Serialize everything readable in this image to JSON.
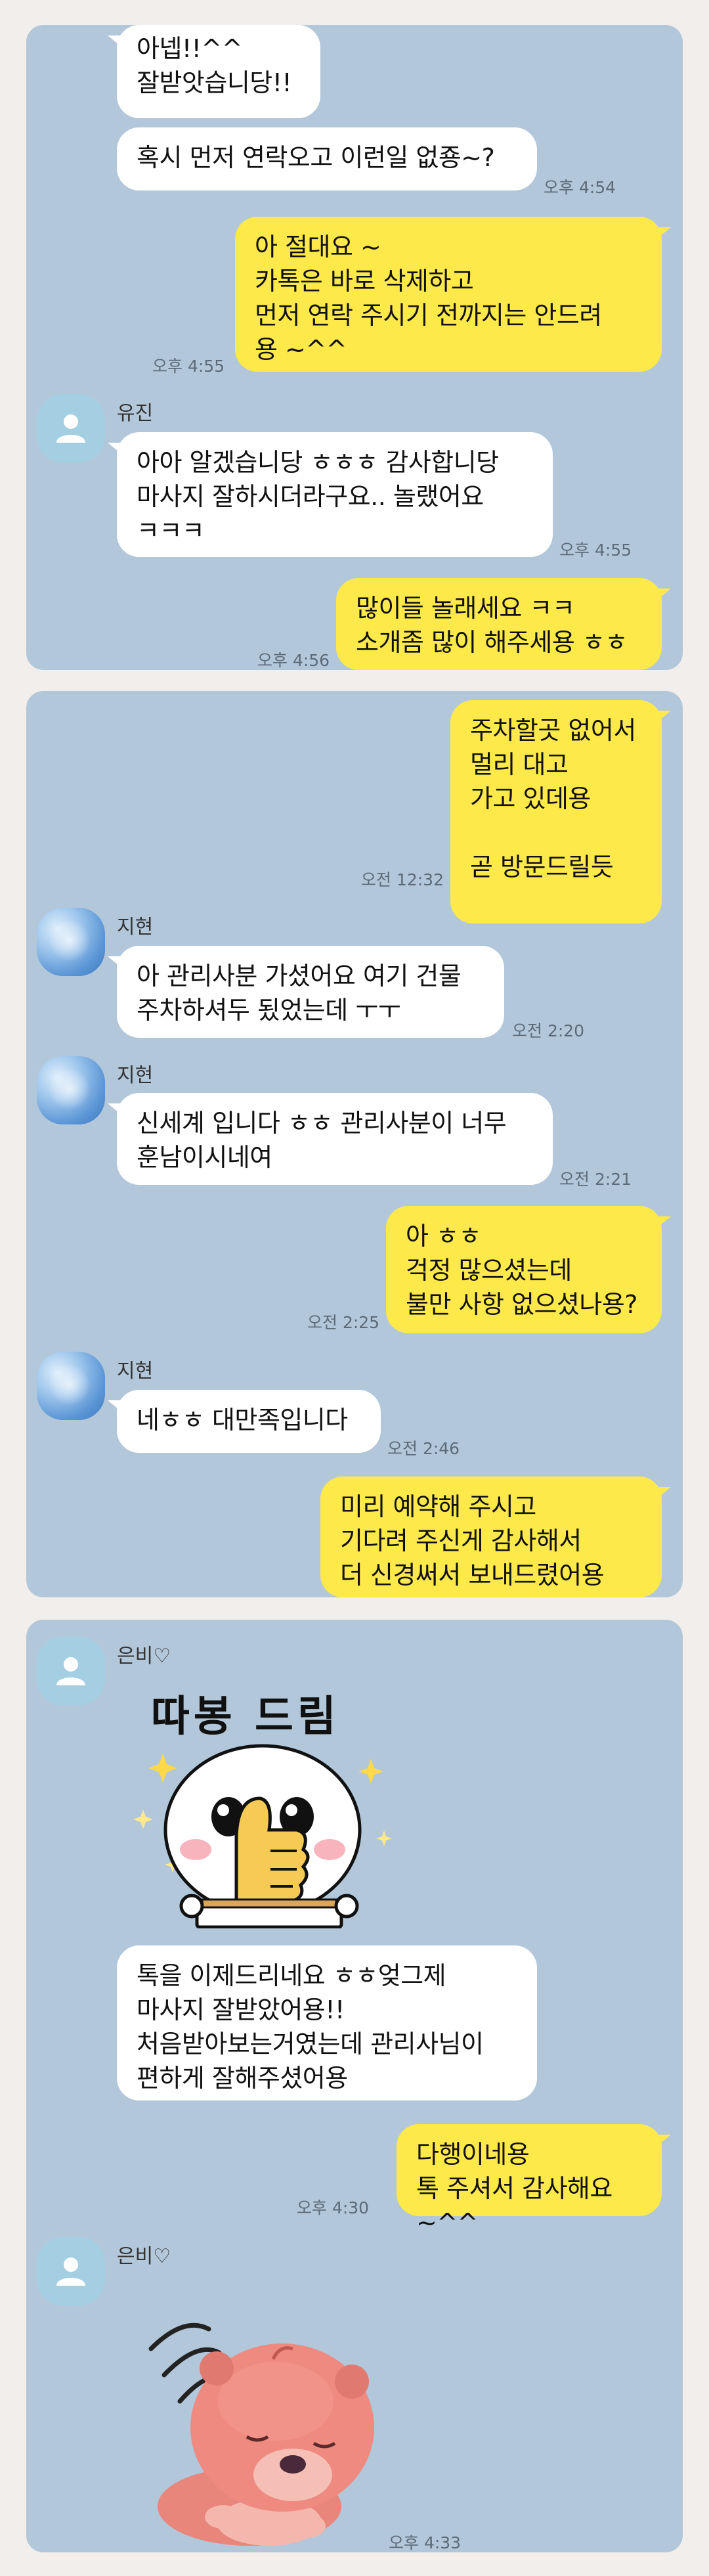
{
  "panel1": {
    "messages": [
      {
        "text": "아넵!!^^\n잘받앗습니당!!"
      },
      {
        "text": "혹시 먼저 연락오고 이런일 없죵~?",
        "time": "오후 4:54"
      },
      {
        "text": "아 절대요 ~\n카톡은 바로 삭제하고\n먼저 연락 주시기 전까지는 안드려\n용 ~^^",
        "time": "오후 4:55"
      },
      {
        "sender": "유진",
        "text": "아아 알겠습니당 ㅎㅎㅎ 감사합니당\n마사지 잘하시더라구요.. 놀랬어요\nㅋㅋㅋ",
        "time": "오후 4:55"
      },
      {
        "text": "많이들 놀래세요 ㅋㅋ\n소개좀 많이 해주세용 ㅎㅎ",
        "time": "오후 4:56"
      }
    ]
  },
  "panel2": {
    "messages": [
      {
        "text": "주차할곳 없어서\n멀리 대고\n가고 있데용\n\n곧 방문드릴듯",
        "time": "오전 12:32"
      },
      {
        "sender": "지현",
        "text": "아 관리사분 가셨어요 여기 건물\n주차하셔두 됬었는데 ㅜㅜ",
        "time": "오전 2:20"
      },
      {
        "sender": "지현",
        "text": "신세계 입니다 ㅎㅎ 관리사분이 너무\n훈남이시네여",
        "time": "오전 2:21"
      },
      {
        "text": "아 ㅎㅎ\n걱정 많으셨는데\n불만 사항 없으셨나용?",
        "time": "오전 2:25"
      },
      {
        "sender": "지현",
        "text": "네ㅎㅎ 대만족입니다",
        "time": "오전 2:46"
      },
      {
        "text": "미리 예약해 주시고\n기다려 주신게 감사해서\n더 신경써서 보내드렸어용 ^^"
      }
    ]
  },
  "panel3": {
    "messages": [
      {
        "sender": "은비♡",
        "sticker_text": "따봉 드림",
        "text": "톡을 이제드리네요 ㅎㅎ엊그제\n마사지 잘받았어용!!\n처음받아보는거였는데 관리사님이\n편하게 잘해주셨어용"
      },
      {
        "text": "다행이네용\n톡 주셔서 감사해요 ~^^",
        "time": "오후 4:30"
      },
      {
        "sender": "은비♡",
        "time": "오후 4:33"
      }
    ]
  },
  "icons": {
    "default_avatar": "person-icon",
    "sticker1": "thumbs-up-character-sticker",
    "sticker2": "pink-beaver-sticker"
  },
  "colors": {
    "chat_bg": "#b2c7da",
    "outgoing_bubble": "#fee94a",
    "incoming_bubble": "#ffffff",
    "page_bg": "#f2eeeb"
  }
}
